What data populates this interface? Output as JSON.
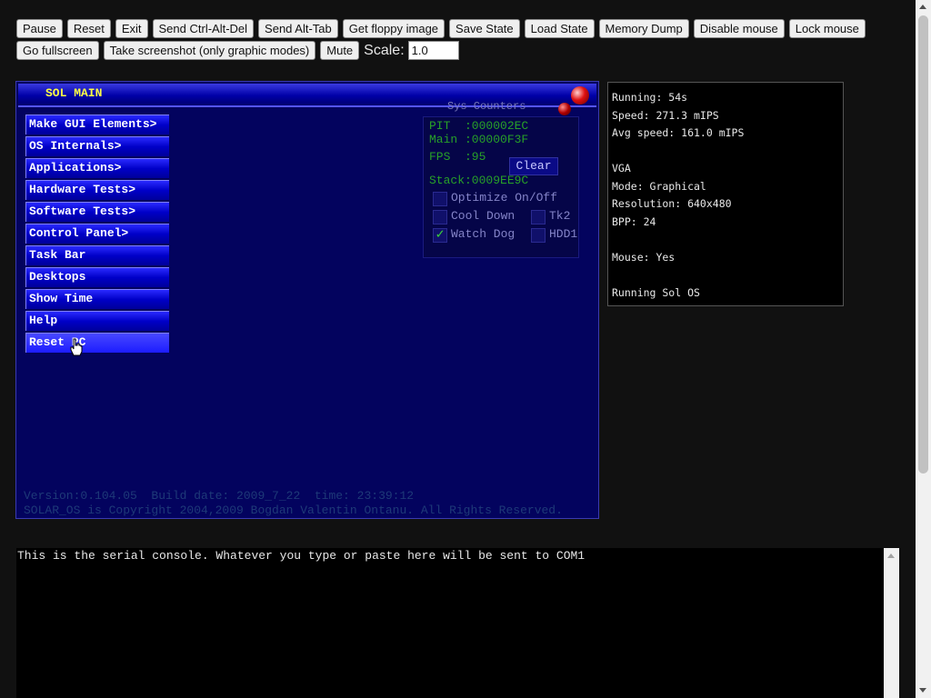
{
  "toolbar": {
    "pause": "Pause",
    "reset": "Reset",
    "exit": "Exit",
    "ctrl_alt_del": "Send Ctrl-Alt-Del",
    "alt_tab": "Send Alt-Tab",
    "floppy": "Get floppy image",
    "save_state": "Save State",
    "load_state": "Load State",
    "memory_dump": "Memory Dump",
    "disable_mouse": "Disable mouse",
    "lock_mouse": "Lock mouse",
    "fullscreen": "Go fullscreen",
    "screenshot": "Take screenshot (only graphic modes)",
    "mute": "Mute",
    "scale_label": "Scale:",
    "scale_value": "1.0"
  },
  "screen": {
    "title": "SOL MAIN",
    "menu": [
      "Make GUI Elements>",
      "OS Internals>",
      "Applications>",
      "Hardware Tests>",
      "Software Tests>",
      "Control Panel>",
      "Task Bar",
      "Desktops",
      "Show Time",
      "Help",
      "Reset PC"
    ],
    "counters": {
      "title": "Sys Counters",
      "pit": "PIT  :000002EC",
      "main": "Main :00000F3F",
      "fps": "FPS  :95",
      "clear": "Clear",
      "stack": "Stack:0009EE9C",
      "optimize": "Optimize On/Off",
      "cool_down": "Cool Down",
      "tk2": "Tk2",
      "watch_dog": "Watch Dog",
      "hdd1": "HDD1"
    },
    "version_line": "Version:0.104.05  Build date: 2009_7_22  time: 23:39:12",
    "copyright_line": "SOLAR_OS is Copyright 2004,2009 Bogdan Valentin Ontanu. All Rights Reserved."
  },
  "info": {
    "running": "Running: 54s",
    "speed": "Speed: 271.3 mIPS",
    "avg_speed": "Avg speed: 161.0 mIPS",
    "vga_header": "VGA",
    "mode": "Mode: Graphical",
    "resolution": "Resolution: 640x480",
    "bpp": "BPP: 24",
    "mouse": "Mouse: Yes",
    "os": "Running Sol OS"
  },
  "console": {
    "text": "This is the serial console. Whatever you type or paste here will be sent to COM1"
  },
  "colors": {
    "screen_bg": "#03035e",
    "menu_item": "#0000c8",
    "title_text": "#ffff44",
    "counter_text": "#28a028"
  }
}
